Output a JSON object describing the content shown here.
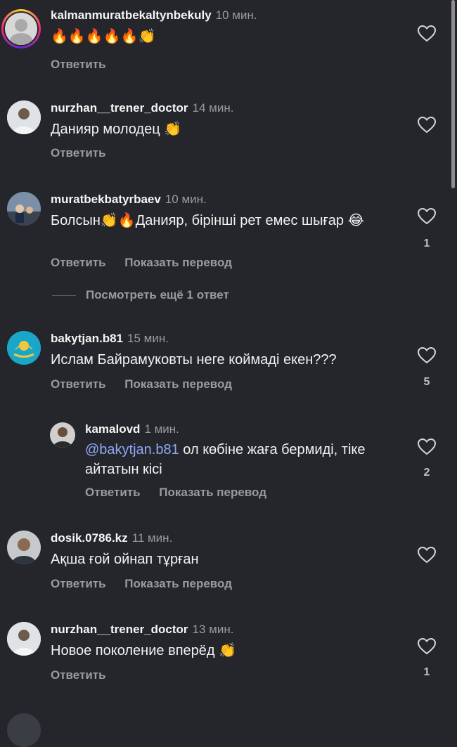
{
  "reply_label": "Ответить",
  "translate_label": "Показать перевод",
  "comments": [
    {
      "user": "kalmanmuratbekaltynbekuly",
      "time": "10 мин.",
      "text": "🔥🔥🔥🔥🔥👏",
      "likes": ""
    },
    {
      "user": "nurzhan__trener_doctor",
      "time": "14 мин.",
      "text": "Данияр молодец 👏",
      "likes": ""
    },
    {
      "user": "muratbekbatyrbaev",
      "time": "10 мин.",
      "text": "Болсын👏🔥Данияр, бірінші рет емес шығар 😂",
      "likes": "1"
    },
    {
      "user": "bakytjan.b81",
      "time": "15 мин.",
      "text": "Ислам Байрамуковты неге коймаді екен???",
      "likes": "5"
    },
    {
      "user": "kamalovd",
      "time": "1 мин.",
      "mention": "@bakytjan.b81",
      "text": " ол көбіне жаға бермиді, тіке айтатын кісі",
      "likes": "2"
    },
    {
      "user": "dosik.0786.kz",
      "time": "11 мин.",
      "text": "Ақша ғой ойнап тұрған",
      "likes": ""
    },
    {
      "user": "nurzhan__trener_doctor",
      "time": "13 мин.",
      "text": "Новое поколение вперёд 👏",
      "likes": "1"
    }
  ],
  "view_more": "Посмотреть ещё 1 ответ"
}
